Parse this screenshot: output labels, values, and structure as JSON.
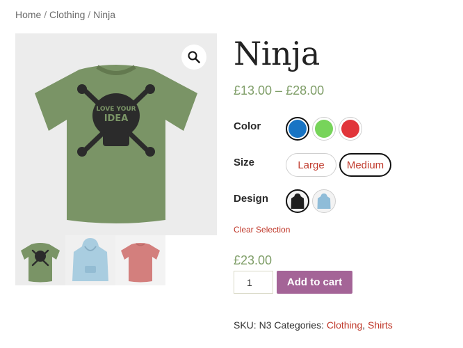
{
  "breadcrumb": {
    "home": "Home",
    "sep1": " / ",
    "category": "Clothing",
    "sep2": " / ",
    "current": "Ninja"
  },
  "product": {
    "title": "Ninja",
    "price_range": "£13.00 – £28.00",
    "price": "£23.00",
    "quantity": "1",
    "add_to_cart_label": "Add to cart",
    "clear_label": "Clear Selection"
  },
  "variations": {
    "color_label": "Color",
    "colors": [
      {
        "name": "blue",
        "hex": "#1874c4",
        "selected": true
      },
      {
        "name": "green",
        "hex": "#77d45a",
        "selected": false
      },
      {
        "name": "red",
        "hex": "#e1353a",
        "selected": false
      }
    ],
    "size_label": "Size",
    "sizes": [
      {
        "label": "Large",
        "selected": false
      },
      {
        "label": "Medium",
        "selected": true
      }
    ],
    "design_label": "Design",
    "designs": [
      {
        "name": "black-hoodie",
        "selected": true
      },
      {
        "name": "blue-hoodie",
        "selected": false
      }
    ]
  },
  "meta": {
    "sku_label": "SKU:",
    "sku": "N3",
    "categories_label": "Categories:",
    "cat1": "Clothing",
    "cat_sep": ",",
    "cat2": "Shirts"
  },
  "gallery": {
    "zoom_icon": "magnifier-icon",
    "thumbnails": [
      "green-tshirt",
      "blue-hoodie",
      "red-tshirt"
    ]
  },
  "colors": {
    "accent": "#a46497",
    "price": "#7f9e68",
    "link": "#c0392b"
  }
}
